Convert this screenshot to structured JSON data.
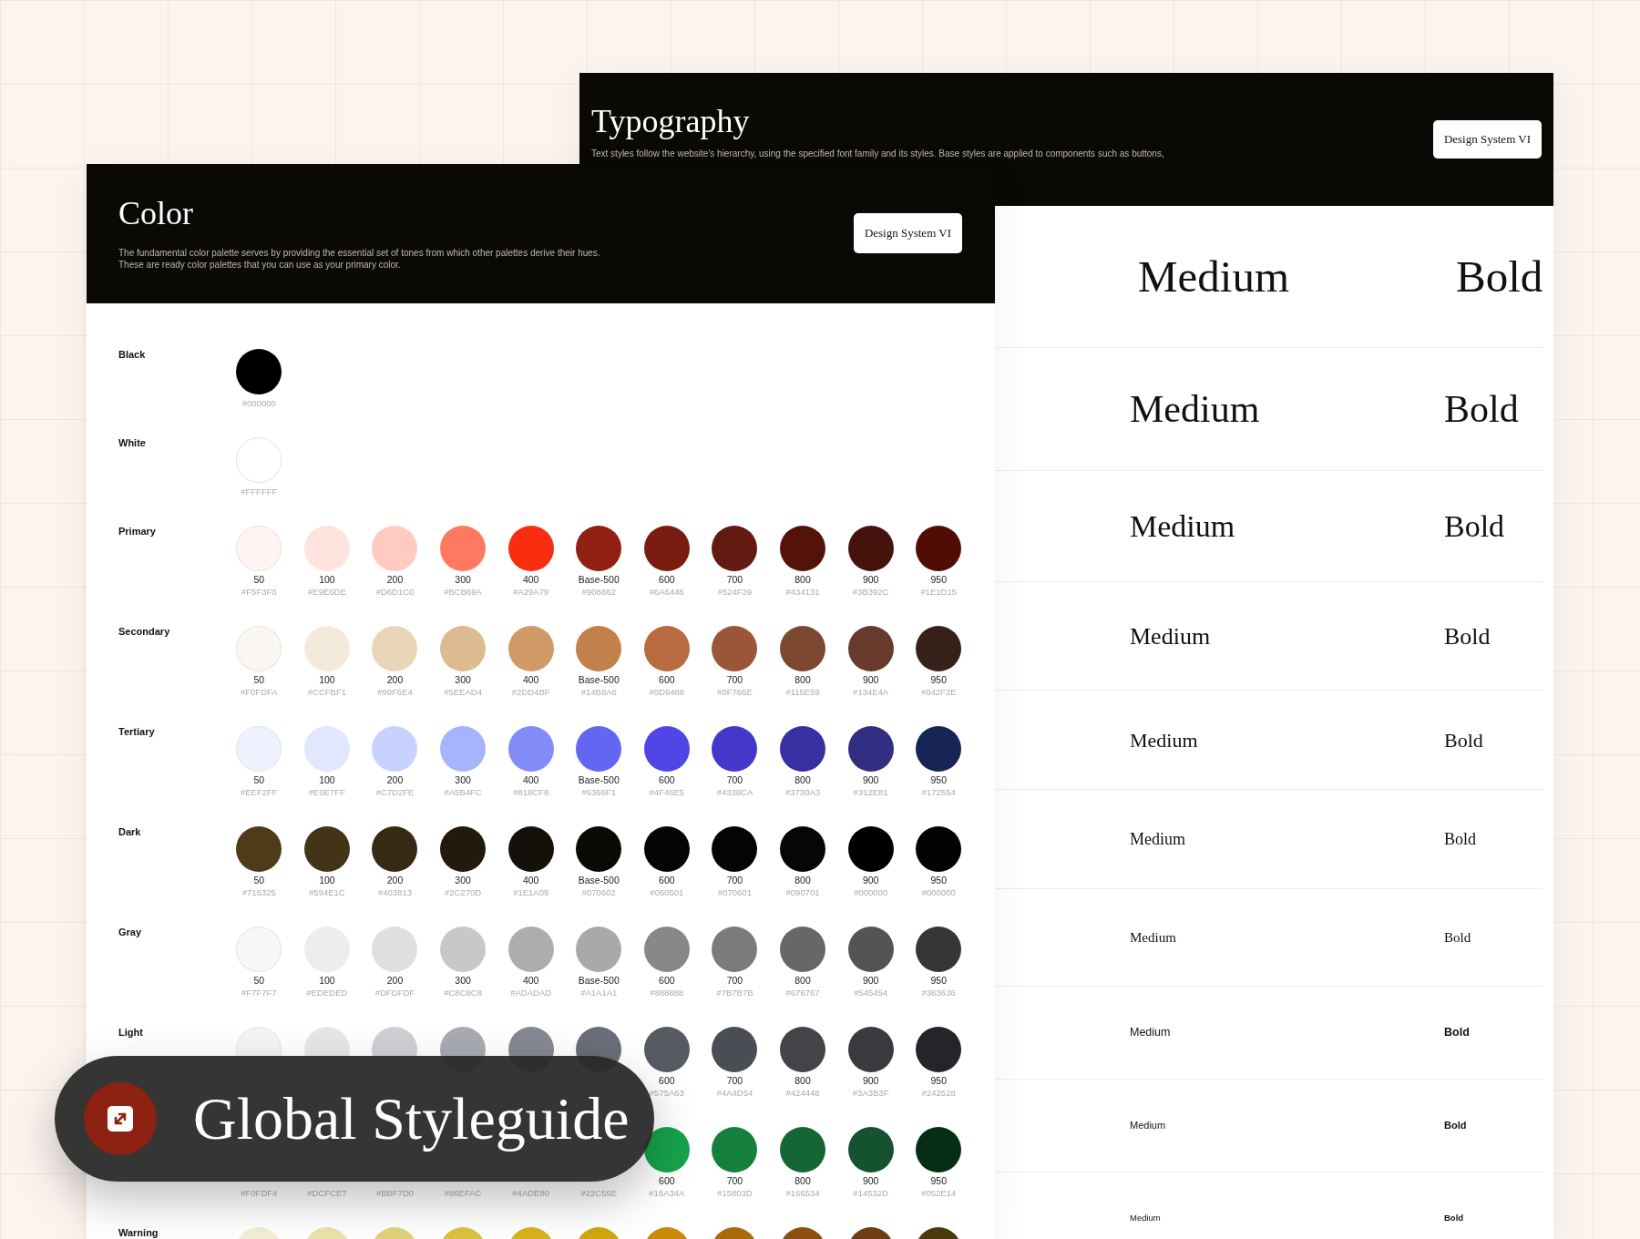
{
  "typography_panel": {
    "title": "Typography",
    "description": "Text styles follow the website's hierarchy, using the specified font family and its styles. Base styles are applied to components such as buttons,",
    "button": "Design System VI",
    "samples": [
      {
        "kind": "serif",
        "medium": "Medium",
        "bold": "Bold"
      },
      {
        "kind": "serif",
        "medium": "Medium",
        "bold": "Bold"
      },
      {
        "kind": "serif",
        "medium": "Medium",
        "bold": "Bold"
      },
      {
        "kind": "serif",
        "medium": "Medium",
        "bold": "Bold"
      },
      {
        "kind": "serif",
        "medium": "Medium",
        "bold": "Bold"
      },
      {
        "kind": "serif",
        "medium": "Medium",
        "bold": "Bold"
      },
      {
        "kind": "serif",
        "medium": "Medium",
        "bold": "Bold"
      },
      {
        "kind": "sans",
        "medium": "Medium",
        "bold": "Bold"
      },
      {
        "kind": "sans",
        "medium": "Medium",
        "bold": "Bold"
      },
      {
        "kind": "sans",
        "medium": "Medium",
        "bold": "Bold"
      }
    ]
  },
  "color_panel": {
    "title": "Color",
    "description": [
      "The fundamental color palette serves by providing the essential set of tones from which other palettes derive their hues.",
      "These are ready color palettes that you can use as your primary color."
    ],
    "button": "Design System VI",
    "palettes": [
      {
        "name": "Black",
        "swatches": [
          {
            "color": "#000000",
            "hex": "#000000"
          }
        ]
      },
      {
        "name": "White",
        "swatches": [
          {
            "color": "#FFFFFF",
            "hex": "#FFFFFF"
          }
        ]
      },
      {
        "name": "Primary",
        "swatches": [
          {
            "color": "#FFF4F2",
            "label": "50",
            "hex": "#F5F3F0"
          },
          {
            "color": "#FFE3DF",
            "label": "100",
            "hex": "#E9E6DE"
          },
          {
            "color": "#FFCBC1",
            "label": "200",
            "hex": "#D6D1C0"
          },
          {
            "color": "#FF7860",
            "label": "300",
            "hex": "#BCB69A"
          },
          {
            "color": "#F92D10",
            "label": "400",
            "hex": "#A29A79"
          },
          {
            "color": "#8F2012",
            "label": "Base-500",
            "hex": "#908862"
          },
          {
            "color": "#7A1D10",
            "label": "600",
            "hex": "#6A6446"
          },
          {
            "color": "#621A11",
            "label": "700",
            "hex": "#524F39"
          },
          {
            "color": "#53130B",
            "label": "800",
            "hex": "#434131"
          },
          {
            "color": "#46130C",
            "label": "900",
            "hex": "#3B392C"
          },
          {
            "color": "#500D05",
            "label": "950",
            "hex": "#1E1D15"
          }
        ]
      },
      {
        "name": "Secondary",
        "swatches": [
          {
            "color": "#FAF6F1",
            "label": "50",
            "hex": "#F0FDFA"
          },
          {
            "color": "#F4EADC",
            "label": "100",
            "hex": "#CCFBF1"
          },
          {
            "color": "#E9D6B8",
            "label": "200",
            "hex": "#99F6E4"
          },
          {
            "color": "#DDBB91",
            "label": "300",
            "hex": "#5EEAD4"
          },
          {
            "color": "#D09A66",
            "label": "400",
            "hex": "#2DD4BF"
          },
          {
            "color": "#C2804A",
            "label": "Base-500",
            "hex": "#14B8A6"
          },
          {
            "color": "#B86B3E",
            "label": "600",
            "hex": "#0D9488"
          },
          {
            "color": "#9A5636",
            "label": "700",
            "hex": "#0F766E"
          },
          {
            "color": "#7D4832",
            "label": "800",
            "hex": "#115E59"
          },
          {
            "color": "#673A2B",
            "label": "900",
            "hex": "#134E4A"
          },
          {
            "color": "#35201A",
            "label": "950",
            "hex": "#042F2E"
          }
        ]
      },
      {
        "name": "Tertiary",
        "swatches": [
          {
            "color": "#EEF2FF",
            "label": "50",
            "hex": "#EEF2FF"
          },
          {
            "color": "#E0E7FF",
            "label": "100",
            "hex": "#E0E7FF"
          },
          {
            "color": "#C7D2FE",
            "label": "200",
            "hex": "#C7D2FE"
          },
          {
            "color": "#A5B4FC",
            "label": "300",
            "hex": "#A5B4FC"
          },
          {
            "color": "#818CF8",
            "label": "400",
            "hex": "#818CF8"
          },
          {
            "color": "#6366F1",
            "label": "Base-500",
            "hex": "#6366F1"
          },
          {
            "color": "#4F46E5",
            "label": "600",
            "hex": "#4F46E5"
          },
          {
            "color": "#4338CA",
            "label": "700",
            "hex": "#4338CA"
          },
          {
            "color": "#3730A3",
            "label": "800",
            "hex": "#3730A3"
          },
          {
            "color": "#312E81",
            "label": "900",
            "hex": "#312E81"
          },
          {
            "color": "#172554",
            "label": "950",
            "hex": "#172554"
          }
        ]
      },
      {
        "name": "Dark",
        "swatches": [
          {
            "color": "#4F3B1A",
            "label": "50",
            "hex": "#716325"
          },
          {
            "color": "#433418",
            "label": "100",
            "hex": "#594E1C"
          },
          {
            "color": "#372913",
            "label": "200",
            "hex": "#403813"
          },
          {
            "color": "#221A0E",
            "label": "300",
            "hex": "#2C270D"
          },
          {
            "color": "#15110A",
            "label": "400",
            "hex": "#1E1A09"
          },
          {
            "color": "#0B0906",
            "label": "Base-500",
            "hex": "#070602"
          },
          {
            "color": "#060504",
            "label": "600",
            "hex": "#060501"
          },
          {
            "color": "#050403",
            "label": "700",
            "hex": "#070601"
          },
          {
            "color": "#080605",
            "label": "800",
            "hex": "#090701"
          },
          {
            "color": "#000000",
            "label": "900",
            "hex": "#000000"
          },
          {
            "color": "#020202",
            "label": "950",
            "hex": "#000000"
          }
        ]
      },
      {
        "name": "Gray",
        "swatches": [
          {
            "color": "#F7F7F7",
            "label": "50",
            "hex": "#F7F7F7"
          },
          {
            "color": "#EDEDED",
            "label": "100",
            "hex": "#EDEDED"
          },
          {
            "color": "#DFDFDF",
            "label": "200",
            "hex": "#DFDFDF"
          },
          {
            "color": "#C8C8C8",
            "label": "300",
            "hex": "#C8C8C8"
          },
          {
            "color": "#ADADAD",
            "label": "400",
            "hex": "#ADADAD"
          },
          {
            "color": "#A9A9A9",
            "label": "Base-500",
            "hex": "#A1A1A1"
          },
          {
            "color": "#888888",
            "label": "600",
            "hex": "#888888"
          },
          {
            "color": "#7B7B7B",
            "label": "700",
            "hex": "#7B7B7B"
          },
          {
            "color": "#676767",
            "label": "800",
            "hex": "#676767"
          },
          {
            "color": "#545454",
            "label": "900",
            "hex": "#545454"
          },
          {
            "color": "#363636",
            "label": "950",
            "hex": "#363636"
          }
        ]
      },
      {
        "name": "Light",
        "swatches": [
          {
            "color": "#F5F5F6"
          },
          {
            "color": "#E6E7E9"
          },
          {
            "color": "#CFD0D4"
          },
          {
            "color": "#A9ABB2"
          },
          {
            "color": "#868993"
          },
          {
            "color": "#6A6E78"
          },
          {
            "color": "#575A63",
            "label": "600",
            "hex": "#575A63"
          },
          {
            "color": "#4A4D54",
            "label": "700",
            "hex": "#4A4D54"
          },
          {
            "color": "#424448",
            "label": "800",
            "hex": "#424448"
          },
          {
            "color": "#3A3B3F",
            "label": "900",
            "hex": "#3A3B3F"
          },
          {
            "color": "#242528",
            "label": "950",
            "hex": "#242528"
          }
        ]
      },
      {
        "swatches": [
          {
            "hex": "#F0FDF4"
          },
          {
            "hex": "#DCFCE7"
          },
          {
            "hex": "#BBF7D0"
          },
          {
            "hex": "#86EFAC"
          },
          {
            "hex": "#4ADE80"
          },
          {
            "hex": "#22C55E"
          },
          {
            "color": "#16A34A",
            "label": "600",
            "hex": "#16A34A"
          },
          {
            "color": "#15803D",
            "label": "700",
            "hex": "#15803D"
          },
          {
            "color": "#166534",
            "label": "800",
            "hex": "#166534"
          },
          {
            "color": "#14532D",
            "label": "900",
            "hex": "#14532D"
          },
          {
            "color": "#052E14",
            "label": "950",
            "hex": "#052E14"
          }
        ]
      },
      {
        "name": "Warning",
        "swatches": [
          {
            "color": "#F3EFD6"
          },
          {
            "color": "#EBE3A8"
          },
          {
            "color": "#E2D37A"
          },
          {
            "color": "#DCC340"
          },
          {
            "color": "#D8B31E"
          },
          {
            "color": "#D4A70F"
          },
          {
            "color": "#C98A0A"
          },
          {
            "color": "#A96A0B"
          },
          {
            "color": "#8C4F10"
          },
          {
            "color": "#6E3D12"
          },
          {
            "color": "#4A3A0E"
          }
        ]
      }
    ]
  },
  "badge": {
    "title": "Global Styleguide"
  }
}
